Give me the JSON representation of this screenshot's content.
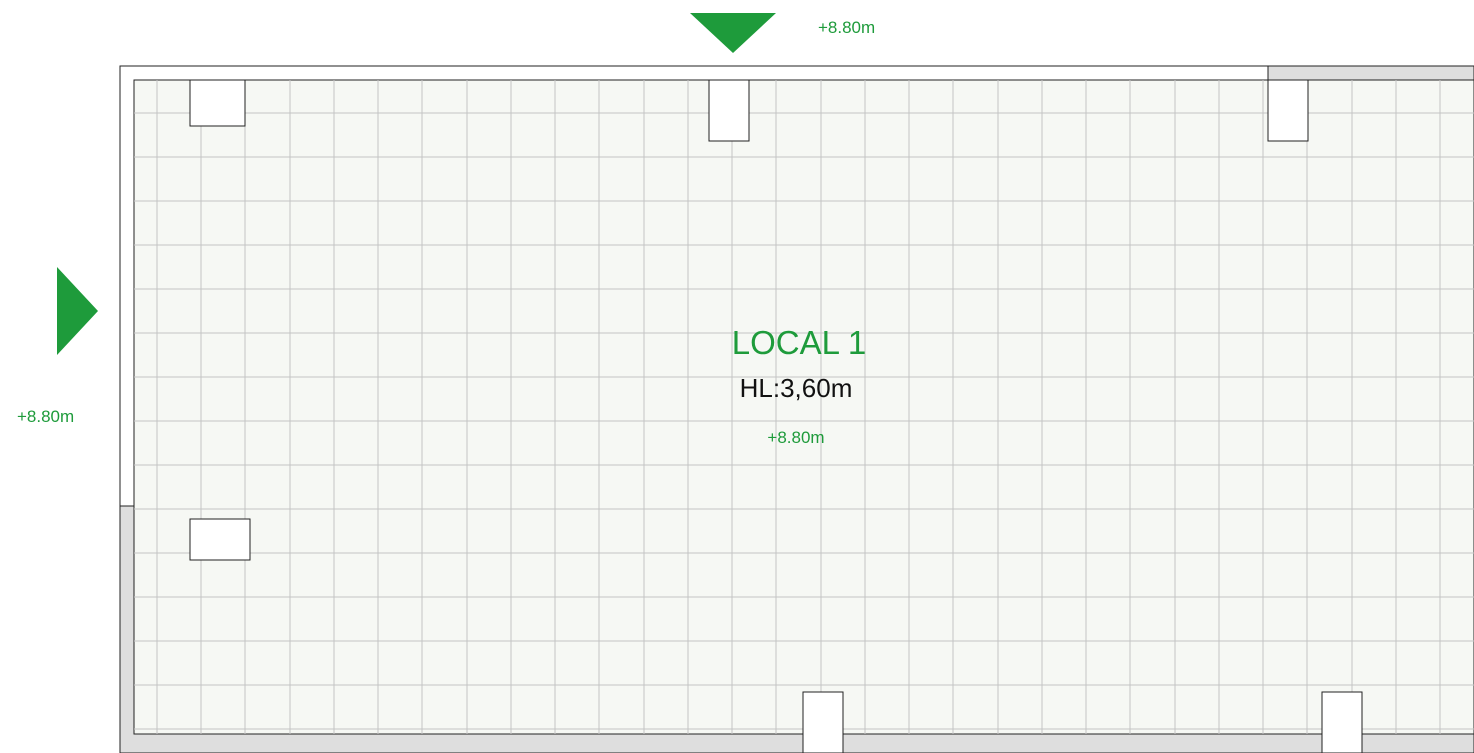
{
  "room": {
    "name": "LOCAL 1",
    "ceiling_height": "HL:3,60m",
    "floor_level": "+8.80m"
  },
  "markers": {
    "top_level": "+8.80m",
    "left_level": "+8.80m"
  },
  "colors": {
    "accent": "#1e9b3b",
    "floor_fill": "#f6f8f4",
    "grid_line": "#c4c4c4",
    "wall_fill": "#dedede",
    "outline": "#222222"
  },
  "icons": {
    "top_marker": "triangle-down-icon",
    "left_marker": "triangle-right-icon"
  }
}
